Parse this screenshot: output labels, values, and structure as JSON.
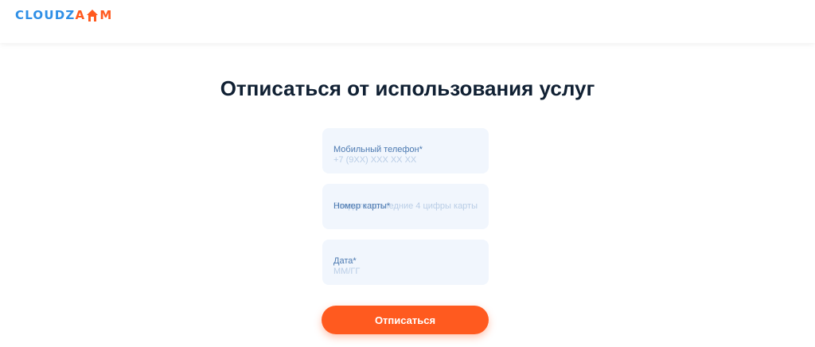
{
  "header": {
    "logo": {
      "part1": "CLOUDZ",
      "part2": "A",
      "part3": "M"
    }
  },
  "main": {
    "title": "Отписаться от использования услуг",
    "fields": {
      "phone": {
        "label": "Мобильный телефон*",
        "placeholder": "+7 (9XX) XXX XX XX"
      },
      "card": {
        "label": "Номер карты*",
        "placeholder": "Введите последние 4 цифры карты"
      },
      "date": {
        "label": "Дата*",
        "placeholder": "ММ/ГГ"
      }
    },
    "submit_label": "Отписаться"
  },
  "colors": {
    "accent": "#ff5a1f",
    "brand_blue": "#2f8fe6",
    "field_bg": "#f1f6fd"
  }
}
